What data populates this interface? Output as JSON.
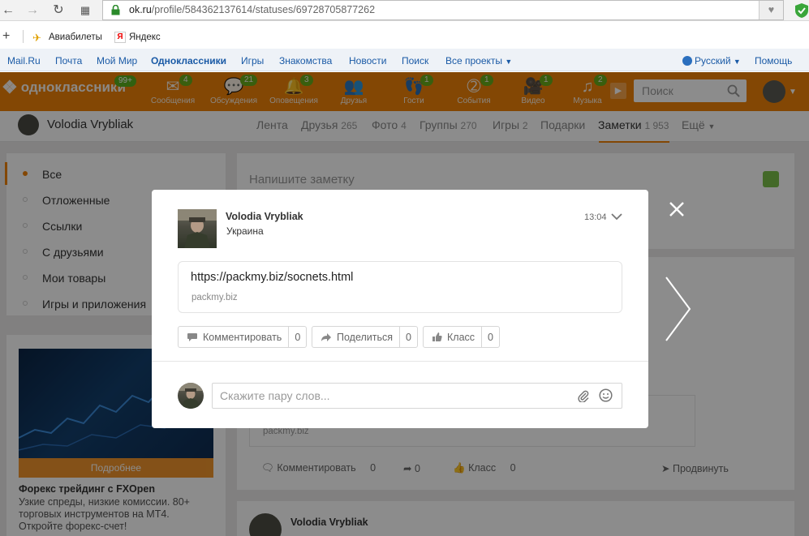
{
  "browser": {
    "url_host": "ok.ru",
    "url_path": "/profile/584362137614/statuses/69728705877262",
    "bookmarks": [
      "Авиабилеты",
      "Яндекс"
    ]
  },
  "portal_nav": {
    "items": [
      "Mail.Ru",
      "Почта",
      "Мой Мир",
      "Одноклассники",
      "Игры",
      "Знакомства",
      "Новости",
      "Поиск",
      "Все проекты"
    ],
    "language": "Русский",
    "help": "Помощь"
  },
  "ok_toolbar": {
    "logo": "одноклассники",
    "logo_badge": "99+",
    "items": [
      {
        "label": "Сообщения",
        "badge": "4",
        "icon": "envelope-icon"
      },
      {
        "label": "Обсуждения",
        "badge": "21",
        "icon": "chat-icon"
      },
      {
        "label": "Оповещения",
        "badge": "3",
        "icon": "bell-icon"
      },
      {
        "label": "Друзья",
        "badge": "",
        "icon": "friends-icon"
      },
      {
        "label": "Гости",
        "badge": "1",
        "icon": "footprints-icon"
      },
      {
        "label": "События",
        "badge": "1",
        "icon": "events-icon"
      },
      {
        "label": "Видео",
        "badge": "1",
        "icon": "video-icon"
      },
      {
        "label": "Музыка",
        "badge": "2",
        "icon": "music-icon"
      }
    ],
    "search_placeholder": "Поиск"
  },
  "profile": {
    "name": "Volodia Vrybliak",
    "tabs": [
      {
        "label": "Лента",
        "count": ""
      },
      {
        "label": "Друзья",
        "count": "265"
      },
      {
        "label": "Фото",
        "count": "4"
      },
      {
        "label": "Группы",
        "count": "270"
      },
      {
        "label": "Игры",
        "count": "2"
      },
      {
        "label": "Подарки",
        "count": ""
      },
      {
        "label": "Заметки",
        "count": "1 953"
      },
      {
        "label": "Ещё",
        "count": ""
      }
    ],
    "active_tab": "Заметки"
  },
  "left_menu": {
    "items": [
      "Все",
      "Отложенные",
      "Ссылки",
      "С друзьями",
      "Мои товары",
      "Игры и приложения"
    ],
    "active": "Все"
  },
  "ad": {
    "more": "Подробнее",
    "title": "Форекс трейдинг с FXOpen",
    "text": "Узкие спреды, низкие комиссии. 80+ торговых инструментов на MT4. Откройте форекс-счет!"
  },
  "feed": {
    "write_placeholder": "Напишите заметку",
    "link_host": "packmy.biz",
    "actions": [
      {
        "label": "Комментировать",
        "count": "0"
      },
      {
        "label": "",
        "count": "0"
      },
      {
        "label": "Класс",
        "count": "0"
      },
      {
        "label": "Продвинуть",
        "count": ""
      }
    ],
    "next_author": "Volodia Vrybliak"
  },
  "modal": {
    "author": "Volodia Vrybliak",
    "location": "Украина",
    "time": "13:04",
    "link_url": "https://packmy.biz/socnets.html",
    "link_host": "packmy.biz",
    "buttons": [
      {
        "label": "Комментировать",
        "count": "0"
      },
      {
        "label": "Поделиться",
        "count": "0"
      },
      {
        "label": "Класс",
        "count": "0"
      }
    ],
    "comment_placeholder": "Скажите пару слов..."
  },
  "colors": {
    "brand_orange": "#ee8208",
    "link_blue": "#1a5aa6",
    "badge_green": "#5ab01e"
  }
}
